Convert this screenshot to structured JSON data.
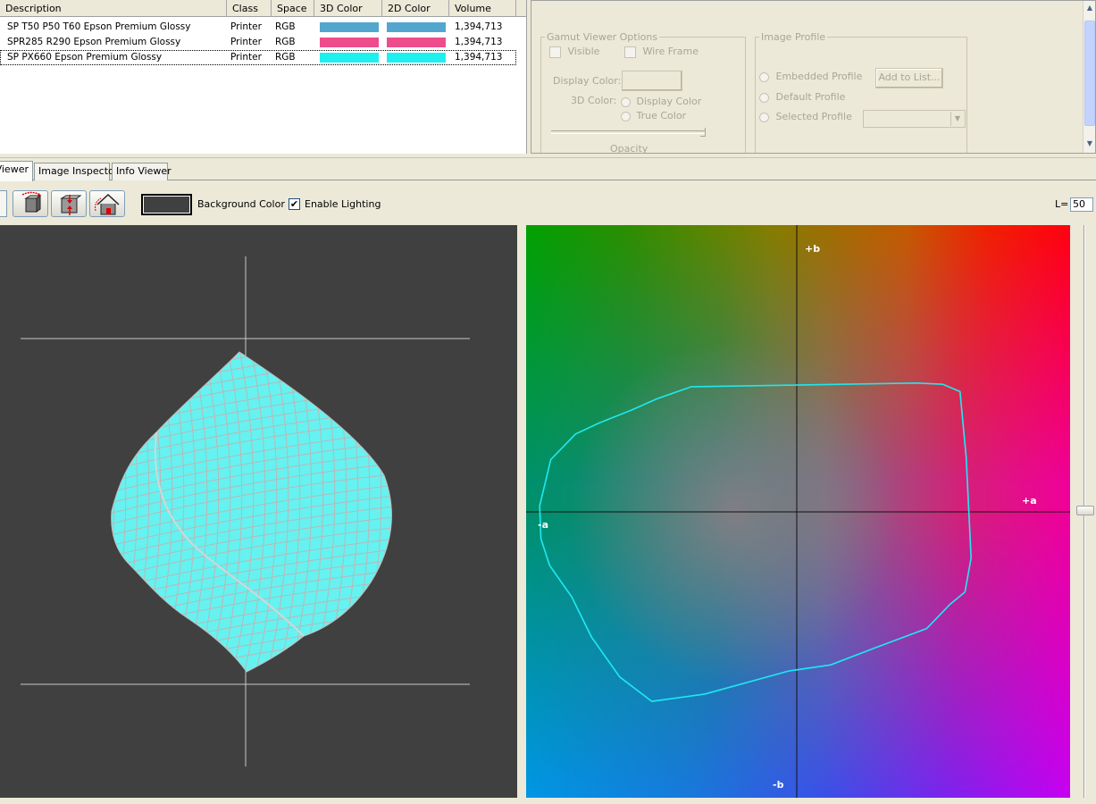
{
  "table": {
    "headers": [
      "Description",
      "Class",
      "Space",
      "3D Color",
      "2D Color",
      "Volume"
    ],
    "rows": [
      {
        "description": "SP T50 P50 T60 Epson Premium Glossy",
        "class": "Printer",
        "space": "RGB",
        "color3d": "#53a7cf",
        "color2d": "#53a7cf",
        "volume": "1,394,713"
      },
      {
        "description": "SPR285 R290 Epson Premium Glossy",
        "class": "Printer",
        "space": "RGB",
        "color3d": "#ee4d8d",
        "color2d": "#ee4d8d",
        "volume": "1,394,713"
      },
      {
        "description": "SP PX660 Epson Premium Glossy",
        "class": "Printer",
        "space": "RGB",
        "color3d": "#1ef0ef",
        "color2d": "#1ef0ef",
        "volume": "1,394,713"
      }
    ]
  },
  "options": {
    "gamut": {
      "legend": "Gamut Viewer Options",
      "visible": "Visible",
      "wireframe": "Wire Frame",
      "display_color": "Display Color:",
      "color3d": "3D Color:",
      "radio_display": "Display Color",
      "radio_true": "True Color",
      "opacity": "Opacity"
    },
    "profile": {
      "legend": "Image Profile",
      "embedded": "Embedded Profile",
      "default": "Default Profile",
      "selected": "Selected Profile",
      "add_button": "Add to List..."
    }
  },
  "tabs": [
    "Viewer",
    "Image Inspector",
    "Info Viewer"
  ],
  "toolbar": {
    "buttons": [
      "rotate-cube-icon",
      "fit-view-icon",
      "home-view-icon"
    ],
    "background_label": "Background Color",
    "background_color": "#404040",
    "lighting_label": "Enable Lighting",
    "lighting_checked": "✔",
    "l_label": "L=",
    "l_value": "50"
  },
  "plot2d": {
    "plus_b": "+b",
    "minus_b": "-b",
    "plus_a": "+a",
    "minus_a": "-a",
    "outline_color": "#1ee8f0"
  },
  "mesh_color": "#66f2f0"
}
